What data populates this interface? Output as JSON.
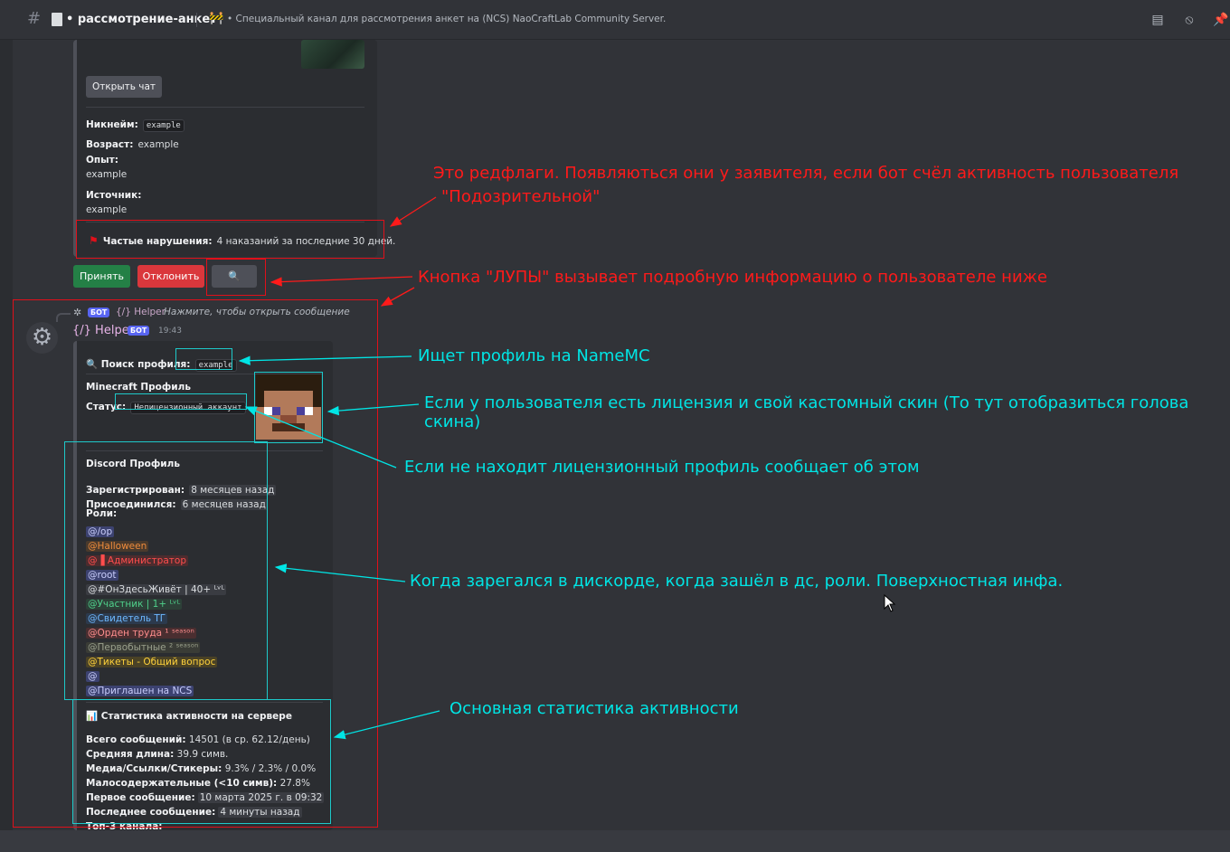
{
  "header": {
    "channel_icon": "hash-icon",
    "channel_name": "рассмотрение-анкет",
    "topic": "• Специальный канал для рассмотрения анкет на (NCS) NaoCraftLab Community Server."
  },
  "application_embed": {
    "open_chat_label": "Открыть чат",
    "fields": [
      {
        "label": "Никнейм:",
        "value": "example"
      },
      {
        "label": "Возраст:",
        "value": "example"
      },
      {
        "label": "Опыт:",
        "value": "example"
      },
      {
        "label": "Источник:",
        "value": "example"
      }
    ],
    "redflag_label": "Частые нарушения:",
    "redflag_value": "4 наказаний за последние 30 дней."
  },
  "actions": {
    "accept_label": "Принять",
    "reject_label": "Отклонить",
    "search_icon": "🔍"
  },
  "reply": {
    "gear": "✲",
    "bot_badge": "БОТ",
    "name": "{/} Helper",
    "hint": "Нажмите, чтобы открыть сообщение"
  },
  "message": {
    "author": "{/} Helper",
    "bot_badge": "БОТ",
    "time": "19:43"
  },
  "profile_embed": {
    "search_label": "🔍 Поиск профиля:",
    "search_value": "example",
    "mc_title": "Minecraft Профиль",
    "status_label": "Статус:",
    "status_value": "Нелицензионный аккаунт",
    "discord_title": "Discord Профиль",
    "registered_label": "Зарегистрирован:",
    "registered_value": "8 месяцев назад",
    "joined_label": "Присоединился:",
    "joined_value": "6 месяцев назад",
    "roles_label": "Роли:",
    "roles": [
      {
        "text": "@/op",
        "color": "#c9cdfb",
        "bg": "#3c4270"
      },
      {
        "text": "@Halloween",
        "color": "#f08c3c",
        "bg": "#4a3a2c"
      },
      {
        "text": "@▐  Администратор",
        "color": "#ff4d4d",
        "bg": "#4d2c2e"
      },
      {
        "text": "@root",
        "color": "#c9cdfb",
        "bg": "#3c4270"
      },
      {
        "text": "@#ОнЗдесьЖивёт | 40+ ᴸᵛᴸ",
        "color": "#dbdee1",
        "bg": "#3a3c42"
      },
      {
        "text": "@Участник | 1+ ᴸᵛᴸ",
        "color": "#4fd18b",
        "bg": "#2d4038"
      },
      {
        "text": "@Свидетель ТГ",
        "color": "#6db8ff",
        "bg": "#2c3a4d"
      },
      {
        "text": "@Орден труда ¹ ˢᵉᵃˢᵒⁿ",
        "color": "#ff8e8e",
        "bg": "#4a2e30"
      },
      {
        "text": "@Первобытные ² ˢᵉᵃˢᵒⁿ",
        "color": "#9aa08c",
        "bg": "#3a3c36"
      },
      {
        "text": "@Тикеты - Общий вопрос",
        "color": "#ffd23c",
        "bg": "#4a4226"
      },
      {
        "text": "@",
        "color": "#c9cdfb",
        "bg": "#3c4270"
      },
      {
        "text": "@Приглашен на NCS",
        "color": "#c9cdfb",
        "bg": "#3c4270"
      }
    ],
    "stats_title": "📊 Статистика активности на сервере",
    "stats": [
      {
        "label": "Всего сообщений:",
        "value": "14501 (в ср. 62.12/день)"
      },
      {
        "label": "Средняя длина:",
        "value": "39.9 симв."
      },
      {
        "label": "Медиа/Ссылки/Стикеры:",
        "value": "9.3% / 2.3% / 0.0%"
      },
      {
        "label": "Малосодержательные (<10 симв):",
        "value": "27.8%"
      },
      {
        "label": "Первое сообщение:",
        "value": "10 марта 2025 г. в 09:32"
      },
      {
        "label": "Последнее сообщение:",
        "value": "4 минуты назад"
      },
      {
        "label": "Топ-3 канала:",
        "value": ""
      }
    ]
  },
  "annotations": {
    "redflags_line1": "Это редфлаги. Появляються они у заявителя, если бот счёл активность пользователя",
    "redflags_line2": "\"Подозрительной\"",
    "magnifier": "Кнопка \"ЛУПЫ\" вызывает подробную информацию о пользователе  ниже",
    "namemc": "Ищет профиль на NameMC",
    "license": "Если у пользователя есть лицензия и свой кастомный скин (То тут отобразиться голова скина)",
    "no_license": "Если не находит лицензионный профиль сообщает об этом",
    "discord_info": "Когда зарегался в дискорде, когда зашёл в дс, роли. Поверхностная инфа.",
    "stats": "Основная статистика активности"
  },
  "colors": {
    "accent_red": "#ff1a1a",
    "accent_cyan": "#00e5e5",
    "accept": "#248046",
    "reject": "#da373c"
  }
}
